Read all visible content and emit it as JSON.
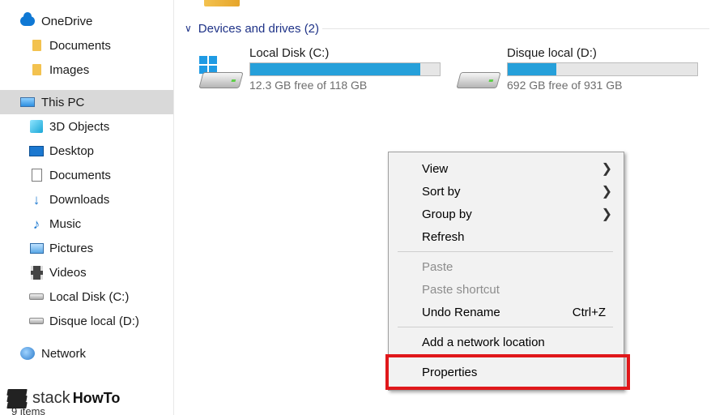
{
  "sidebar": {
    "items": [
      {
        "label": "OneDrive",
        "icon": "onedrive-cloud-icon"
      },
      {
        "label": "Documents",
        "icon": "folder-icon"
      },
      {
        "label": "Images",
        "icon": "folder-icon"
      },
      {
        "label": "This PC",
        "icon": "this-pc-icon",
        "selected": true
      },
      {
        "label": "3D Objects",
        "icon": "3d-objects-icon"
      },
      {
        "label": "Desktop",
        "icon": "desktop-icon"
      },
      {
        "label": "Documents",
        "icon": "documents-icon"
      },
      {
        "label": "Downloads",
        "icon": "downloads-icon"
      },
      {
        "label": "Music",
        "icon": "music-icon"
      },
      {
        "label": "Pictures",
        "icon": "pictures-icon"
      },
      {
        "label": "Videos",
        "icon": "videos-icon"
      },
      {
        "label": "Local Disk (C:)",
        "icon": "drive-icon"
      },
      {
        "label": "Disque local (D:)",
        "icon": "drive-icon"
      },
      {
        "label": "Network",
        "icon": "network-icon"
      }
    ]
  },
  "main": {
    "group_header": "Devices and drives (2)",
    "drives": [
      {
        "name": "Local Disk (C:)",
        "free_text": "12.3 GB free of 118 GB",
        "used_fraction": 0.896
      },
      {
        "name": "Disque local (D:)",
        "free_text": "692 GB free of 931 GB",
        "used_fraction": 0.257
      }
    ]
  },
  "context_menu": {
    "items": [
      {
        "label": "View",
        "submenu": true
      },
      {
        "label": "Sort by",
        "submenu": true
      },
      {
        "label": "Group by",
        "submenu": true
      },
      {
        "label": "Refresh"
      },
      {
        "label": "Paste",
        "disabled": true
      },
      {
        "label": "Paste shortcut",
        "disabled": true
      },
      {
        "label": "Undo Rename",
        "shortcut": "Ctrl+Z"
      },
      {
        "label": "Add a network location"
      },
      {
        "label": "Properties",
        "highlighted": true
      }
    ]
  },
  "status_bar": {
    "item_count": "9 items"
  },
  "watermark": {
    "part1": "stack",
    "part2": "HowTo"
  },
  "colors": {
    "accent_bar": "#26a0da",
    "highlight_box": "#e0181b",
    "group_header": "#1e3287",
    "selected_nav": "#d9d9d9"
  }
}
